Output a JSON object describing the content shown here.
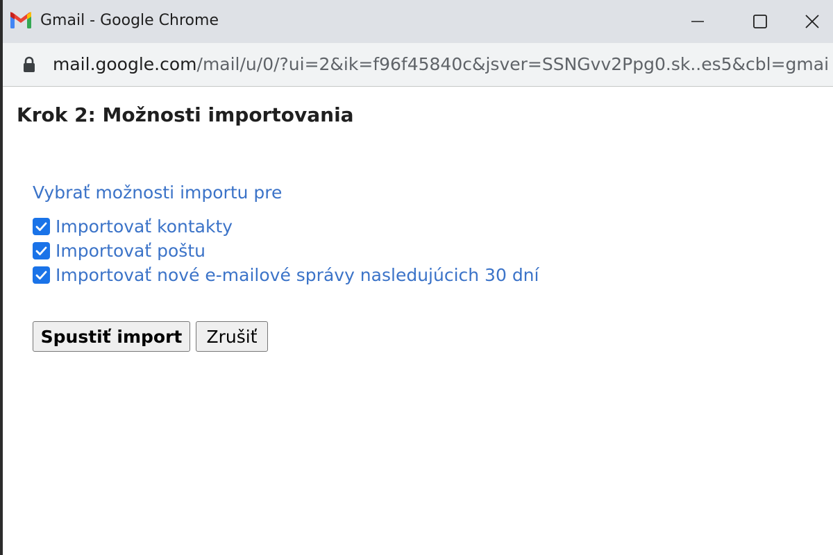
{
  "window": {
    "title": "Gmail - Google Chrome",
    "icon": "gmail-logo"
  },
  "address_bar": {
    "host": "mail.google.com",
    "path": "/mail/u/0/?ui=2&ik=f96f45840c&jsver=SSNGvv2Ppg0.sk..es5&cbl=gmai..."
  },
  "dialog": {
    "heading": "Krok 2: Možnosti importovania",
    "options_label": "Vybrať možnosti importu pre",
    "options": [
      {
        "label": "Importovať kontakty",
        "checked": true
      },
      {
        "label": "Importovať poštu",
        "checked": true
      },
      {
        "label": "Importovať nové e-mailové správy nasledujúcich 30 dní",
        "checked": true
      }
    ],
    "start_button": "Spustiť import",
    "cancel_button": "Zrušiť"
  },
  "colors": {
    "accent_link": "#3b73c8",
    "checkbox": "#1a73e8",
    "titlebar": "#dee1e6"
  }
}
